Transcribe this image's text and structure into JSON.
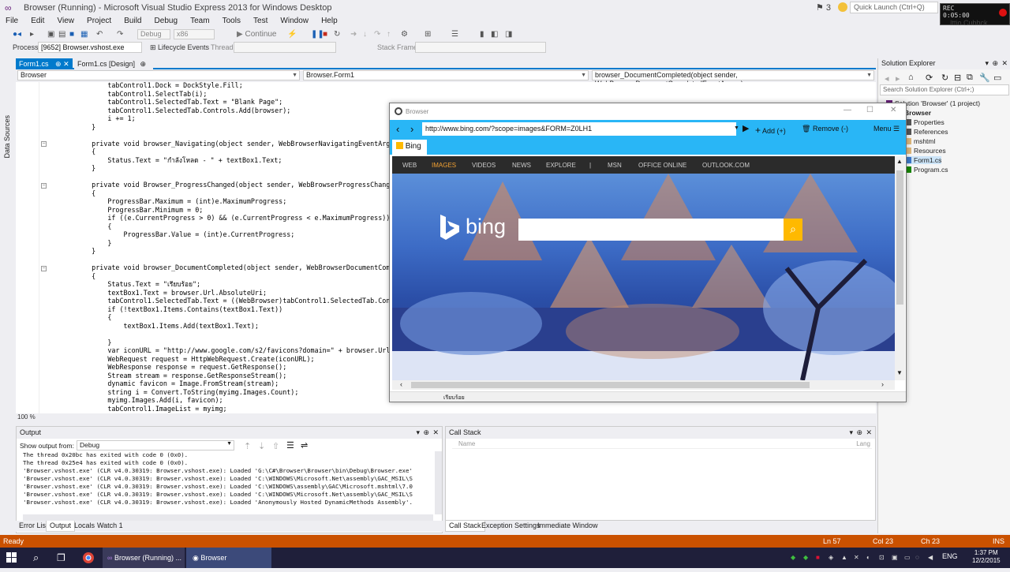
{
  "titlebar": {
    "title": "Browser (Running) - Microsoft Visual Studio Express 2013 for Windows Desktop",
    "notifications": "3",
    "quick_launch_placeholder": "Quick Launch (Ctrl+Q)",
    "recorder": {
      "line1": "REC",
      "line2": "13 ",
      "time": "0:05:00"
    },
    "user": "Ittio Cubhck"
  },
  "menu": [
    "File",
    "Edit",
    "View",
    "Project",
    "Build",
    "Debug",
    "Team",
    "Tools",
    "Test",
    "Window",
    "Help"
  ],
  "toolbar": {
    "config": "Debug",
    "platform": "x86",
    "continue_label": "Continue",
    "lifecycle": "Lifecycle Events",
    "thread_label": "Thread:",
    "stackframe_label": "Stack Frame:"
  },
  "processbar": {
    "label": "Process:",
    "value": "[9652] Browser.vshost.exe"
  },
  "left_strip": {
    "label": "Data Sources"
  },
  "doc_tabs": [
    {
      "label": "Form1.cs",
      "active": true
    },
    {
      "label": "Form1.cs [Design]",
      "active": false
    }
  ],
  "nav": {
    "project": "Browser",
    "type": "Browser.Form1",
    "member": "browser_DocumentCompleted(object sender, WebBrowserDocumentCompletedEventArgs e)"
  },
  "zoom": "100 %",
  "code_lines": [
    {
      "t": "        tabControl1.Dock = DockStyle.Fill;"
    },
    {
      "t": "        tabControl1.SelectTab(i);"
    },
    {
      "t": "        tabControl1.SelectedTab.Text = \"Blank Page\";"
    },
    {
      "t": "        tabControl1.SelectedTab.Controls.Add(browser);"
    },
    {
      "t": "        i += 1;"
    },
    {
      "t": "    }"
    },
    {
      "t": ""
    },
    {
      "t": "    private void browser_Navigating(object sender, WebBrowserNavigatingEventArgs e)"
    },
    {
      "t": "    {"
    },
    {
      "t": "        Status.Text = \"กำลังโหลด - \" + textBox1.Text;"
    },
    {
      "t": "    }"
    },
    {
      "t": ""
    },
    {
      "t": "    private void Browser_ProgressChanged(object sender, WebBrowserProgressChangedEventArg"
    },
    {
      "t": "    {"
    },
    {
      "t": "        ProgressBar.Maximum = (int)e.MaximumProgress;"
    },
    {
      "t": "        ProgressBar.Minimum = 0;"
    },
    {
      "t": "        if ((e.CurrentProgress > 0) && (e.CurrentProgress < e.MaximumProgress))"
    },
    {
      "t": "        {"
    },
    {
      "t": "            ProgressBar.Value = (int)e.CurrentProgress;"
    },
    {
      "t": "        }"
    },
    {
      "t": "    }"
    },
    {
      "t": ""
    },
    {
      "t": "    private void browser_DocumentCompleted(object sender, WebBrowserDocumentCompletedEven"
    },
    {
      "t": "    {"
    },
    {
      "t": "        Status.Text = \"เรียบร้อย\";"
    },
    {
      "t": "        textBox1.Text = browser.Url.AbsoluteUri;"
    },
    {
      "t": "        tabControl1.SelectedTab.Text = ((WebBrowser)tabControl1.SelectedTab.Controls[0])."
    },
    {
      "t": "        if (!textBox1.Items.Contains(textBox1.Text))"
    },
    {
      "t": "        {"
    },
    {
      "t": "            textBox1.Items.Add(textBox1.Text);"
    },
    {
      "t": ""
    },
    {
      "t": "        }"
    },
    {
      "t": "        var iconURL = \"http://www.google.com/s2/favicons?domain=\" + browser.Url.Host;"
    },
    {
      "t": "        WebRequest request = HttpWebRequest.Create(iconURL);"
    },
    {
      "t": "        WebResponse response = request.GetResponse();"
    },
    {
      "t": "        Stream stream = response.GetResponseStream();"
    },
    {
      "t": "        dynamic favicon = Image.FromStream(stream);"
    },
    {
      "t": "        string i = Convert.ToString(myimg.Images.Count);"
    },
    {
      "t": "        myimg.Images.Add(i, favicon);"
    },
    {
      "t": "        tabControl1.ImageList = myimg;"
    }
  ],
  "solution_explorer": {
    "title": "Solution Explorer",
    "search_placeholder": "Search Solution Explorer (Ctrl+;)",
    "items": [
      {
        "label": "Solution 'Browser' (1 project)",
        "depth": 0
      },
      {
        "label": "Browser",
        "depth": 1
      },
      {
        "label": "Properties",
        "depth": 2
      },
      {
        "label": "References",
        "depth": 2
      },
      {
        "label": "mshtml",
        "depth": 2
      },
      {
        "label": "Resources",
        "depth": 2
      },
      {
        "label": "Form1.cs",
        "depth": 2
      },
      {
        "label": "Program.cs",
        "depth": 2
      }
    ]
  },
  "browser": {
    "title": "Browser",
    "url": "http://www.bing.com/?scope=images&FORM=Z0LH1",
    "add_label": "Add (+)",
    "remove_label": "Remove (-)",
    "menu_label": "Menu",
    "tab_label": "Bing",
    "bing_nav": [
      "WEB",
      "IMAGES",
      "VIDEOS",
      "NEWS",
      "EXPLORE",
      "|",
      "MSN",
      "OFFICE ONLINE",
      "OUTLOOK.COM"
    ],
    "bing_logo": "bing",
    "status": "เรียบร้อย",
    "colors": {
      "accent": "#29b6f6",
      "bing_nav_active": "#f2a133"
    }
  },
  "output": {
    "title": "Output",
    "show_from_label": "Show output from:",
    "source": "Debug",
    "lines": [
      "The thread 0x20bc has exited with code 0 (0x0).",
      "The thread 0x25e4 has exited with code 0 (0x0).",
      "'Browser.vshost.exe' (CLR v4.0.30319: Browser.vshost.exe): Loaded 'G:\\C#\\Browser\\Browser\\bin\\Debug\\Browser.exe'",
      "'Browser.vshost.exe' (CLR v4.0.30319: Browser.vshost.exe): Loaded 'C:\\WINDOWS\\Microsoft.Net\\assembly\\GAC_MSIL\\S",
      "'Browser.vshost.exe' (CLR v4.0.30319: Browser.vshost.exe): Loaded 'C:\\WINDOWS\\assembly\\GAC\\Microsoft.mshtml\\7.0",
      "'Browser.vshost.exe' (CLR v4.0.30319: Browser.vshost.exe): Loaded 'C:\\WINDOWS\\Microsoft.Net\\assembly\\GAC_MSIL\\S",
      "'Browser.vshost.exe' (CLR v4.0.30319: Browser.vshost.exe): Loaded 'Anonymously Hosted DynamicMethods Assembly'."
    ]
  },
  "bottom_tabs_left": [
    "Error List",
    "Output",
    "Locals",
    "Watch 1"
  ],
  "callstack": {
    "title": "Call Stack",
    "col_name": "Name",
    "col_lang": "Lang"
  },
  "bottom_tabs_right": [
    "Call Stack",
    "Exception Settings",
    "Immediate Window"
  ],
  "statusbar": {
    "ready": "Ready",
    "ln": "Ln 57",
    "col": "Col 23",
    "ch": "Ch 23",
    "ins": "INS"
  },
  "taskbar": {
    "vs_label": "Browser (Running) ...",
    "browser_label": "Browser",
    "lang": "ENG",
    "time": "1:37 PM",
    "date": "12/2/2015"
  }
}
